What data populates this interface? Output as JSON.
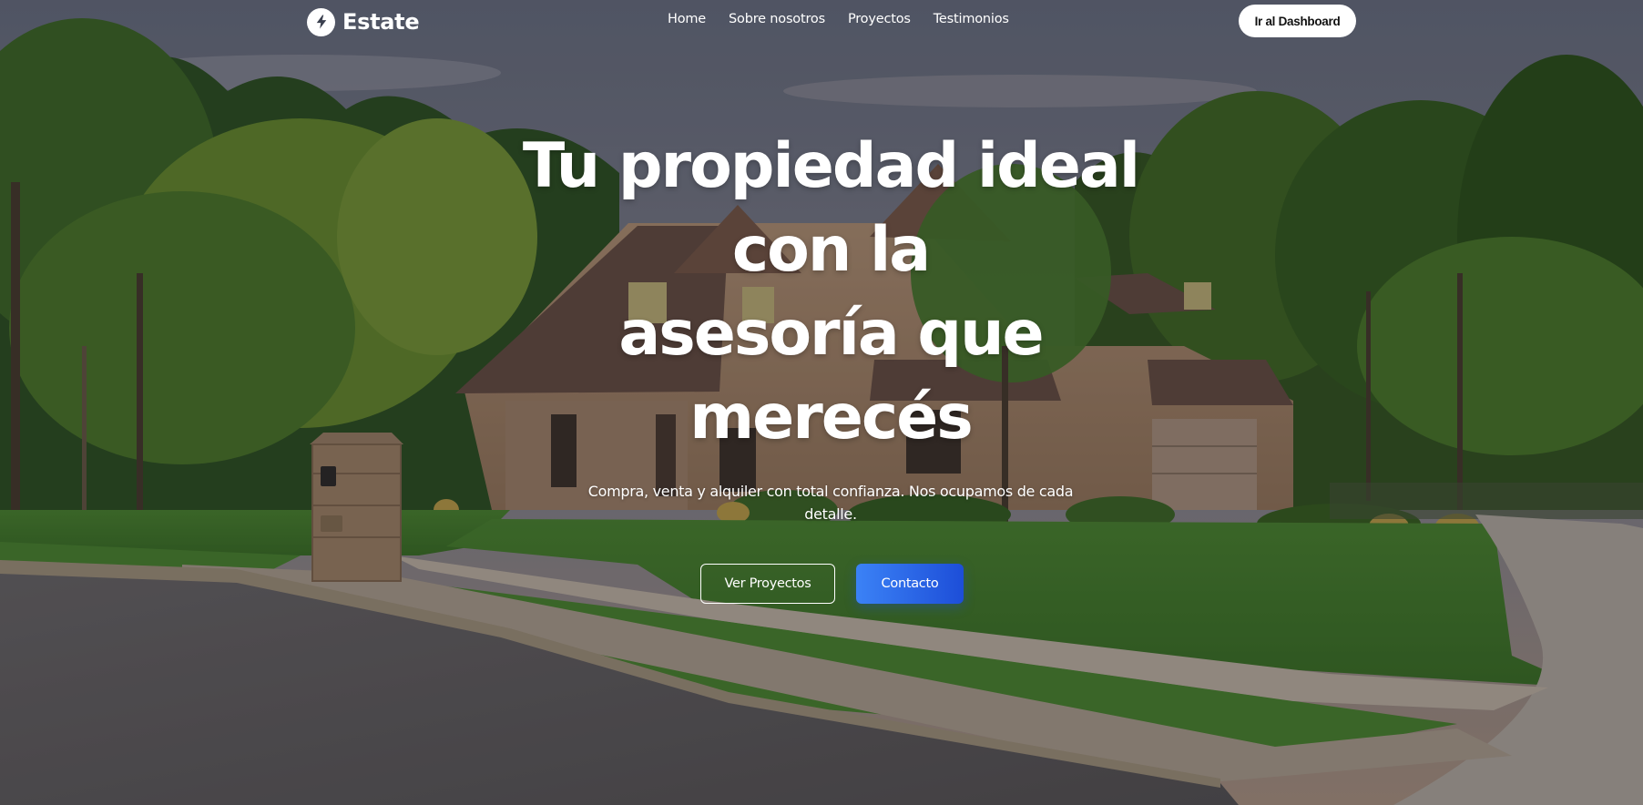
{
  "nav": {
    "brand": "Estate",
    "brand_icon": "bolt-icon",
    "links": [
      {
        "label": "Home"
      },
      {
        "label": "Sobre nosotros"
      },
      {
        "label": "Proyectos"
      },
      {
        "label": "Testimonios"
      }
    ],
    "dashboard_button": "Ir al Dashboard"
  },
  "hero": {
    "title_lines": [
      "Tu propiedad ideal",
      "con la",
      "asesoría que",
      "merecés"
    ],
    "subtitle": "Compra, venta y alquiler con total confianza. Nos ocupamos de cada detalle.",
    "secondary_button": "Ver Proyectos",
    "primary_button": "Contacto",
    "background_image": "suburban-house-photo"
  },
  "colors": {
    "accent": "#2563eb",
    "text": "#ffffff"
  }
}
